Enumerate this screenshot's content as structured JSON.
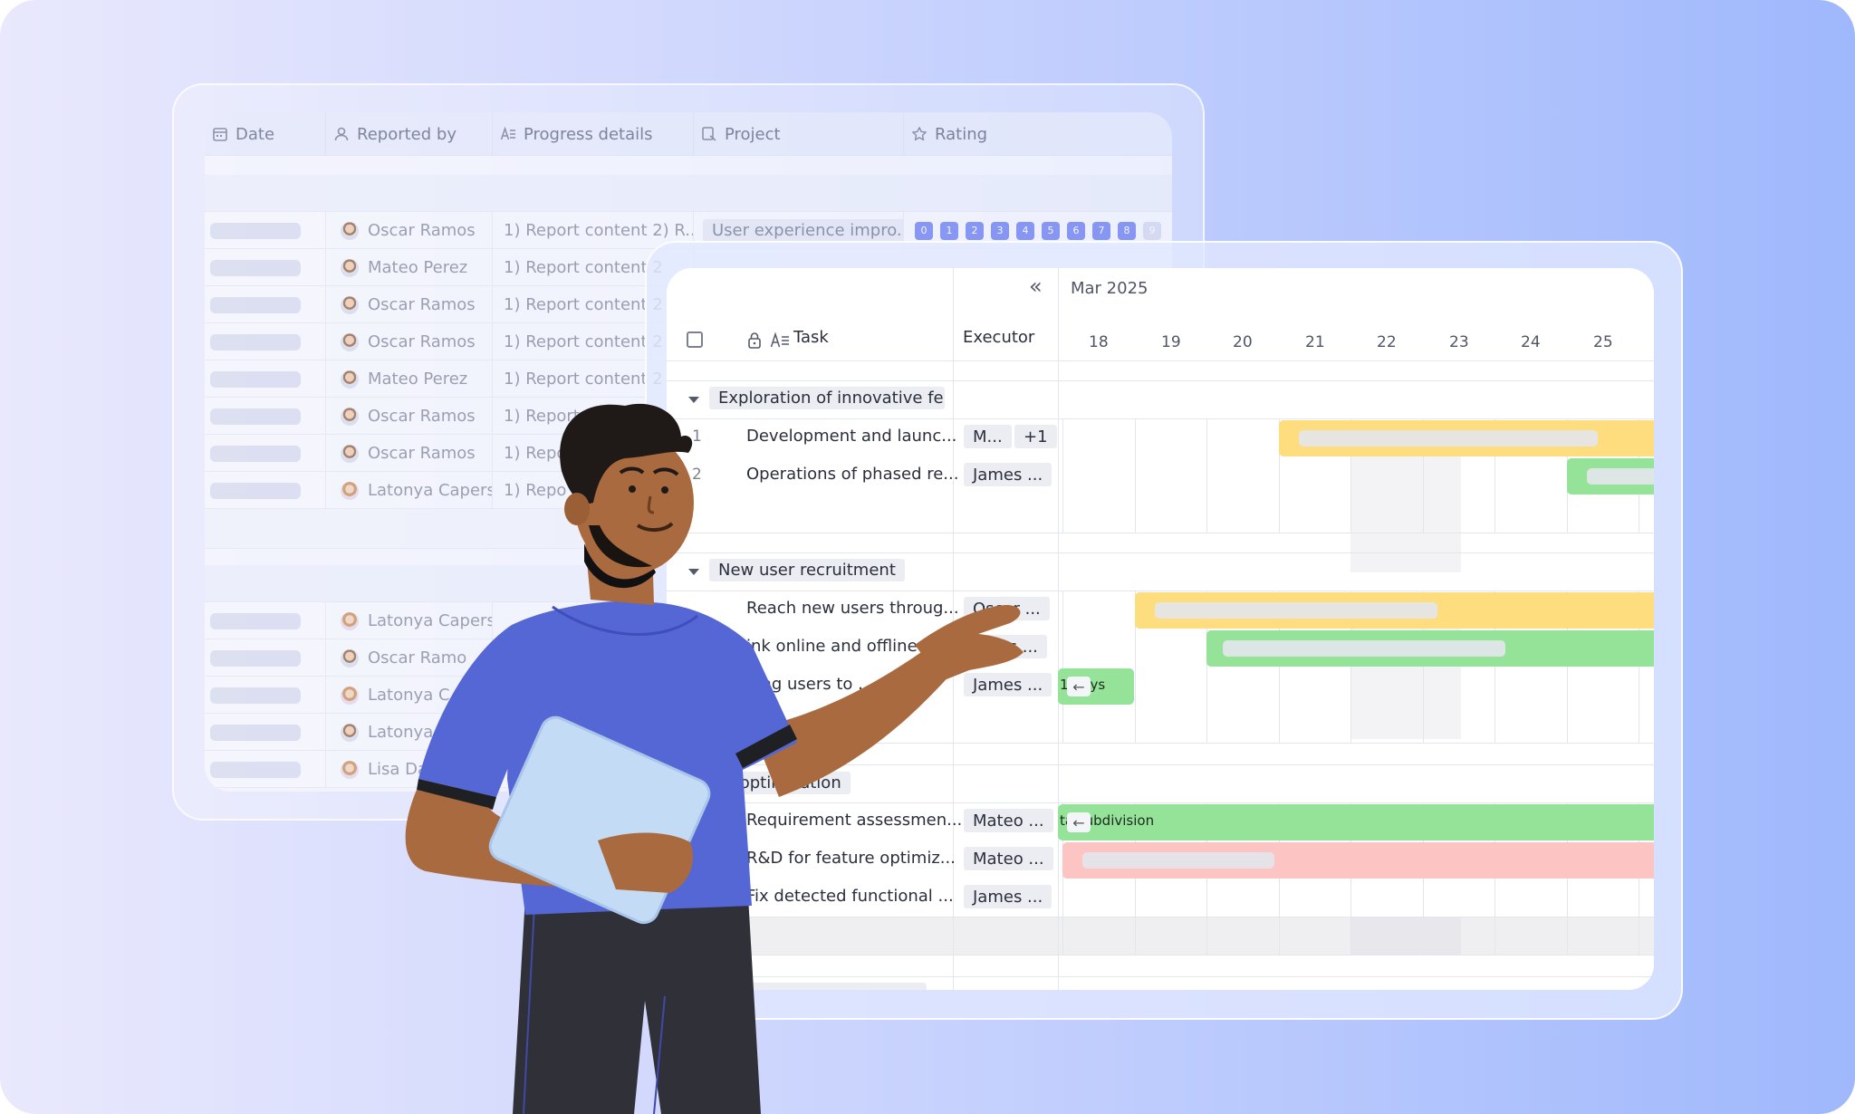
{
  "sheet": {
    "columns": {
      "date": "Date",
      "reported_by": "Reported by",
      "progress": "Progress details",
      "project": "Project",
      "rating": "Rating"
    },
    "progress_text": "1) Report content 2) R...",
    "progress_text_short": "1) Report content 2",
    "progress_text_cut": "1) Repo",
    "project_tag": "User experience impro...",
    "rating_levels": [
      "0",
      "1",
      "2",
      "3",
      "4",
      "5",
      "6",
      "7",
      "8",
      "9"
    ],
    "rows_a": [
      "Oscar Ramos",
      "Mateo Perez",
      "Oscar Ramos",
      "Oscar Ramos",
      "Mateo Perez",
      "Oscar Ramos",
      "Oscar Ramos",
      "Latonya Capers"
    ],
    "rows_b": [
      "Latonya Capers",
      "Oscar Ramo",
      "Latonya C",
      "Latonya",
      "Lisa Da"
    ]
  },
  "gantt": {
    "month": "Mar 2025",
    "collapse_icon": "«",
    "task_col": "Task",
    "executor_col": "Executor",
    "days": [
      "18",
      "19",
      "20",
      "21",
      "22",
      "23",
      "24",
      "25"
    ],
    "groups": [
      {
        "label": "Exploration of innovative fe...",
        "tasks": [
          {
            "num": "1",
            "name": "Development and launc...",
            "exec": "M...",
            "extra": "+1"
          },
          {
            "num": "2",
            "name": "Operations of phased re...",
            "exec": "James ..."
          }
        ],
        "add": "+"
      },
      {
        "label": "New user recruitment",
        "tasks": [
          {
            "name": "Reach new users throug...",
            "exec": "Oscar ..."
          },
          {
            "name": "ink online and offline",
            "exec": "ames ..."
          },
          {
            "name": "ding users to ...",
            "exec": "James ..."
          }
        ]
      },
      {
        "label": "ro            optimization",
        "tasks": [
          {
            "name": "Requirement assessmen...",
            "exec": "Mateo ..."
          },
          {
            "name": "R&D for feature optimiz...",
            "exec": "Mateo ..."
          },
          {
            "name": "Fix detected functional ...",
            "exec": "James ..."
          }
        ]
      }
    ],
    "bar_labels": {
      "days": "1(    lays",
      "subdivision": "ta     subdivision"
    }
  }
}
